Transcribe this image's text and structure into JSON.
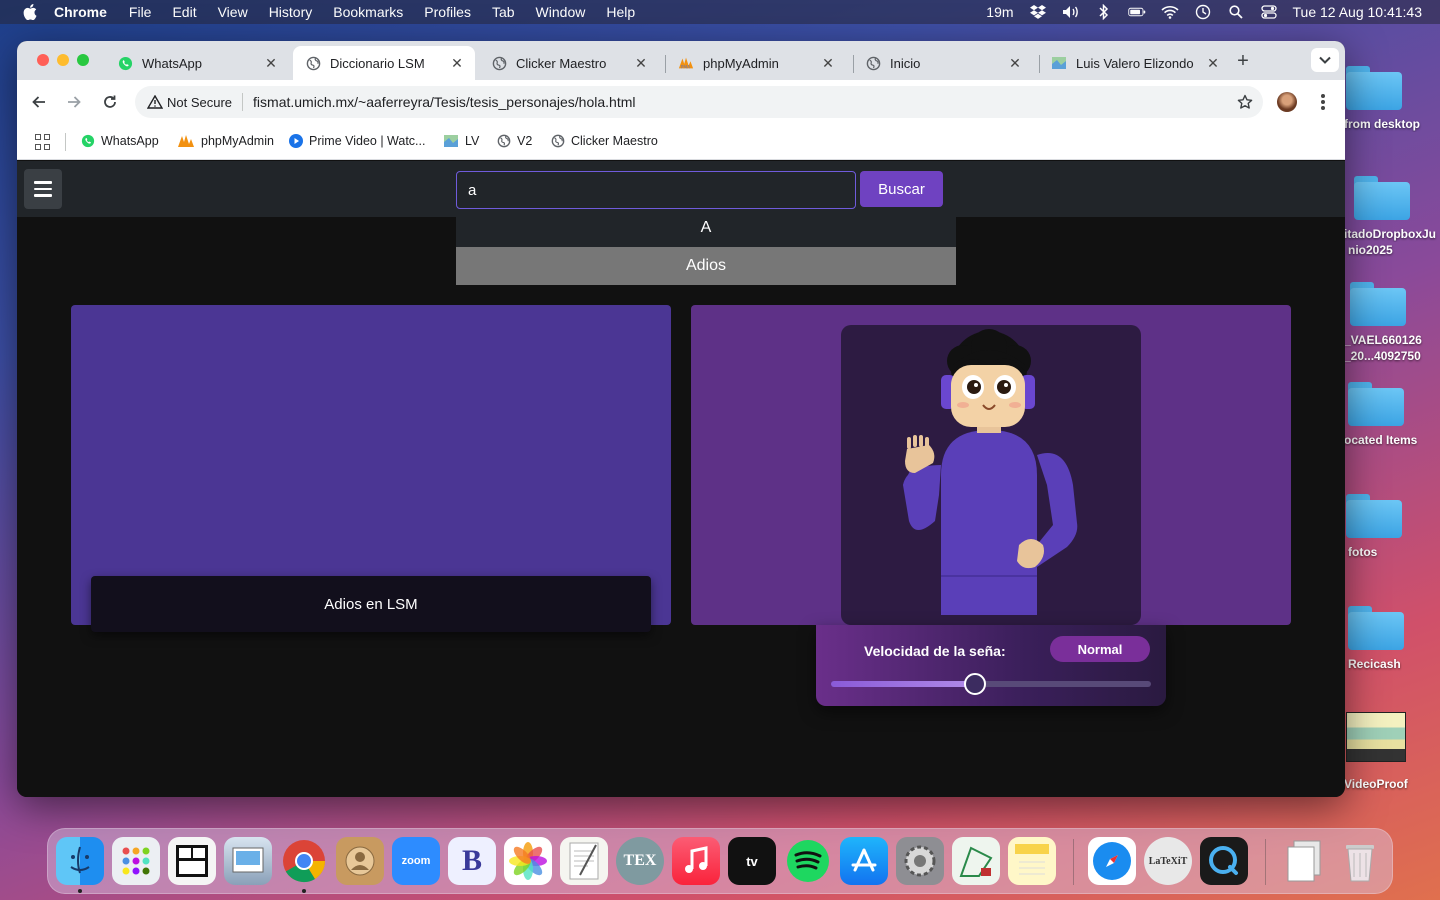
{
  "menubar": {
    "app": "Chrome",
    "items": [
      "File",
      "Edit",
      "View",
      "History",
      "Bookmarks",
      "Profiles",
      "Tab",
      "Window",
      "Help"
    ],
    "status_time_left": "19m",
    "datetime": "Tue 12 Aug  10:41:43"
  },
  "desktop": {
    "items": [
      {
        "label": "from desktop"
      },
      {
        "label": "itadoDropboxJu",
        "label2": "nio2025"
      },
      {
        "label": "_VAEL660126",
        "label2": "_20...4092750"
      },
      {
        "label": "ocated Items"
      },
      {
        "label": "fotos"
      },
      {
        "label": "Recicash"
      },
      {
        "label": "VideoProof"
      }
    ]
  },
  "browser": {
    "tabs": [
      {
        "title": "WhatsApp",
        "icon": "whatsapp-icon"
      },
      {
        "title": "Diccionario LSM",
        "icon": "globe-icon",
        "active": true
      },
      {
        "title": "Clicker Maestro",
        "icon": "globe-icon"
      },
      {
        "title": "phpMyAdmin",
        "icon": "phpmyadmin-icon"
      },
      {
        "title": "Inicio",
        "icon": "globe-icon"
      },
      {
        "title": "Luis Valero Elizondo",
        "icon": "map-icon"
      }
    ],
    "security_label": "Not Secure",
    "url": "fismat.umich.mx/~aaferreyra/Tesis/tesis_personajes/hola.html",
    "bookmarks": [
      {
        "label": "WhatsApp",
        "icon": "whatsapp-icon"
      },
      {
        "label": "phpMyAdmin",
        "icon": "phpmyadmin-icon"
      },
      {
        "label": "Prime Video | Watc...",
        "icon": "prime-video-icon"
      },
      {
        "label": "LV",
        "icon": "map-icon"
      },
      {
        "label": "V2",
        "icon": "globe-icon"
      },
      {
        "label": "Clicker Maestro",
        "icon": "globe-icon"
      }
    ]
  },
  "page": {
    "search_value": "a",
    "search_button": "Buscar",
    "suggestions": [
      "A",
      "Adios"
    ],
    "caption": "Adios en LSM",
    "speed_label": "Velocidad de la seña:",
    "speed_value": "Normal",
    "speed_slider_fraction": 0.45
  },
  "colors": {
    "accent": "#6f42c1",
    "card_left": "#4b3694",
    "card_right": "#5e3187"
  }
}
